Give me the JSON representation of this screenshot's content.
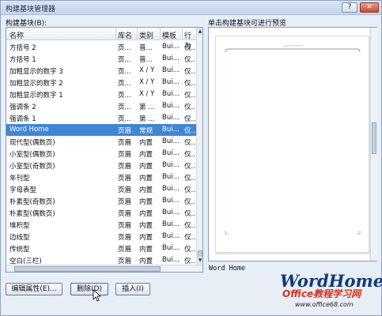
{
  "window": {
    "title": "构建基块管理器",
    "help_label": "?",
    "close_label": "✕"
  },
  "list_label": "构建基块(B):",
  "preview_label": "单击构建基块可进行预览",
  "columns": [
    "名称",
    "库名",
    "类别",
    "模板",
    "行为"
  ],
  "rows": [
    {
      "name": "方括号 2",
      "gallery": "页...",
      "category": "普...",
      "template": "Bui...",
      "behavior": "仅..."
    },
    {
      "name": "方括号 1",
      "gallery": "页...",
      "category": "普...",
      "template": "Bui...",
      "behavior": "仅..."
    },
    {
      "name": "加粗显示的数字 3",
      "gallery": "页...",
      "category": "X / Y",
      "template": "Bui...",
      "behavior": "仅..."
    },
    {
      "name": "加粗显示的数字 2",
      "gallery": "页...",
      "category": "X / Y",
      "template": "Bui...",
      "behavior": "仅..."
    },
    {
      "name": "加粗显示的数字 1",
      "gallery": "页...",
      "category": "X / Y",
      "template": "Bui...",
      "behavior": "仅..."
    },
    {
      "name": "强调条 2",
      "gallery": "页...",
      "category": "第 ...",
      "template": "Bui...",
      "behavior": "仅..."
    },
    {
      "name": "强调条 1",
      "gallery": "页...",
      "category": "第 ...",
      "template": "Bui...",
      "behavior": "仅..."
    },
    {
      "name": "Word Home",
      "gallery": "页眉",
      "category": "常规",
      "template": "Bui...",
      "behavior": "仅...",
      "selected": true
    },
    {
      "name": "现代型(偶数页)",
      "gallery": "页眉",
      "category": "内置",
      "template": "Bui...",
      "behavior": "仅..."
    },
    {
      "name": "小室型(偶数页)",
      "gallery": "页眉",
      "category": "内置",
      "template": "Bui...",
      "behavior": "仅..."
    },
    {
      "name": "小室型(奇数页)",
      "gallery": "页眉",
      "category": "内置",
      "template": "Bui...",
      "behavior": "仅..."
    },
    {
      "name": "年刊型",
      "gallery": "页眉",
      "category": "内置",
      "template": "Bui...",
      "behavior": "仅..."
    },
    {
      "name": "字母表型",
      "gallery": "页眉",
      "category": "内置",
      "template": "Bui...",
      "behavior": "仅..."
    },
    {
      "name": "朴素型(奇数页)",
      "gallery": "页眉",
      "category": "内置",
      "template": "Bui...",
      "behavior": "仅..."
    },
    {
      "name": "朴素型(偶数页)",
      "gallery": "页眉",
      "category": "内置",
      "template": "Bui...",
      "behavior": "仅..."
    },
    {
      "name": "堆积型",
      "gallery": "页眉",
      "category": "内置",
      "template": "Bui...",
      "behavior": "仅..."
    },
    {
      "name": "边线型",
      "gallery": "页眉",
      "category": "内置",
      "template": "Bui...",
      "behavior": "仅..."
    },
    {
      "name": "传统型",
      "gallery": "页眉",
      "category": "内置",
      "template": "Bui...",
      "behavior": "仅..."
    },
    {
      "name": "空白(三栏)",
      "gallery": "页眉",
      "category": "内置",
      "template": "Bui...",
      "behavior": "仅..."
    }
  ],
  "buttons": {
    "edit": "编辑属性(E)...",
    "delete": "删除(D)",
    "insert": "插入(I)"
  },
  "preview_name": "Word Home",
  "watermark": {
    "brand": "WordHome",
    "cn": "Office教程学习网",
    "url": "www.office68.com"
  }
}
